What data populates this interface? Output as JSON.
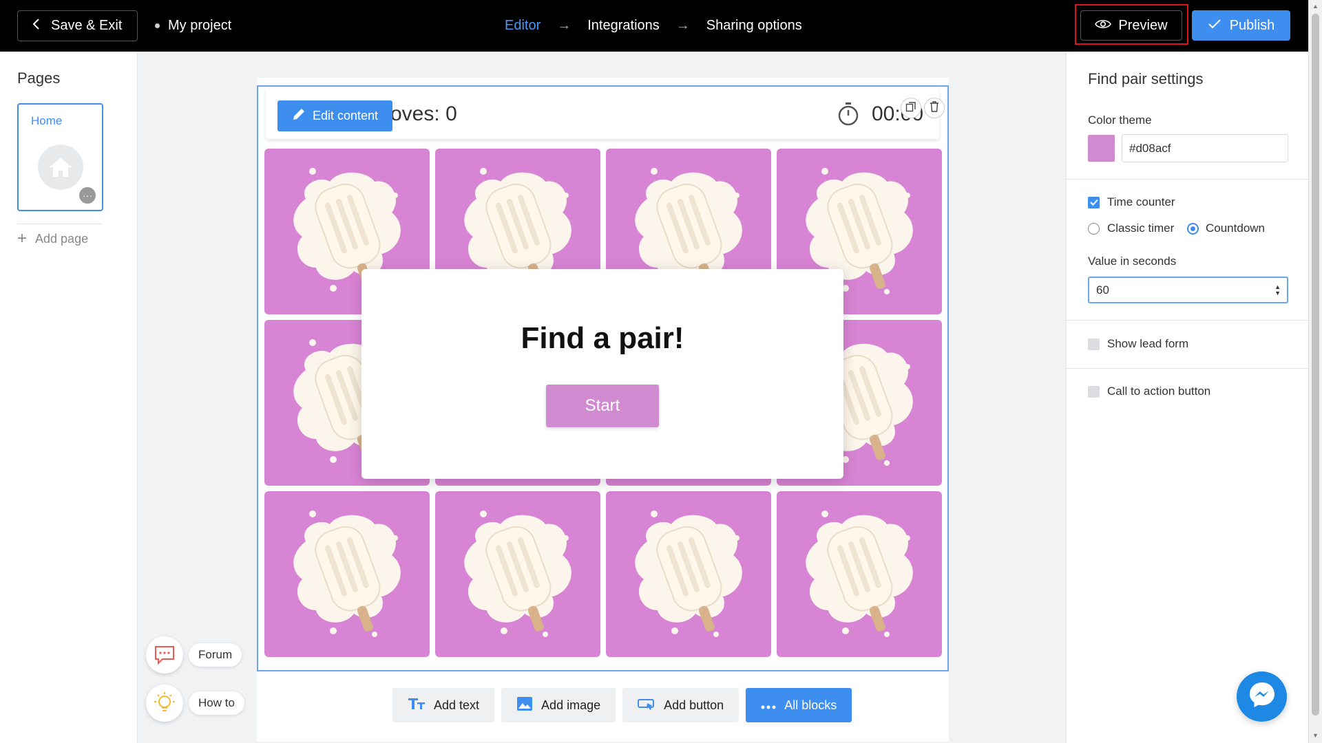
{
  "topbar": {
    "save_exit_label": "Save & Exit",
    "project_name": "My project",
    "steps": [
      {
        "label": "Editor",
        "active": true
      },
      {
        "label": "Integrations",
        "active": false
      },
      {
        "label": "Sharing options",
        "active": false
      }
    ],
    "preview_label": "Preview",
    "publish_label": "Publish"
  },
  "pages": {
    "title": "Pages",
    "items": [
      {
        "label": "Home"
      }
    ],
    "add_page_label": "Add page"
  },
  "game": {
    "moves_label": "oves:",
    "moves_value": "0",
    "timer_value": "00:00",
    "edit_content_label": "Edit content",
    "tile_count": 12,
    "tile_color": "#d884d4",
    "modal_title": "Find a pair!",
    "start_label": "Start"
  },
  "toolbar": {
    "add_text": "Add text",
    "add_image": "Add image",
    "add_button": "Add button",
    "all_blocks": "All blocks"
  },
  "settings": {
    "title": "Find pair settings",
    "color_theme_label": "Color theme",
    "color_theme_value": "#d08acf",
    "time_counter_label": "Time counter",
    "time_counter_checked": true,
    "classic_timer_label": "Classic timer",
    "countdown_label": "Countdown",
    "selected_timer": "Countdown",
    "value_seconds_label": "Value in seconds",
    "value_seconds": "60",
    "show_lead_form_label": "Show lead form",
    "show_lead_form_checked": false,
    "cta_label": "Call to action button",
    "cta_checked": false
  },
  "help": {
    "forum_label": "Forum",
    "howto_label": "How to"
  },
  "colors": {
    "accent": "#3e8ef0",
    "preview_highlight": "#e0121a",
    "theme": "#d08acf"
  }
}
